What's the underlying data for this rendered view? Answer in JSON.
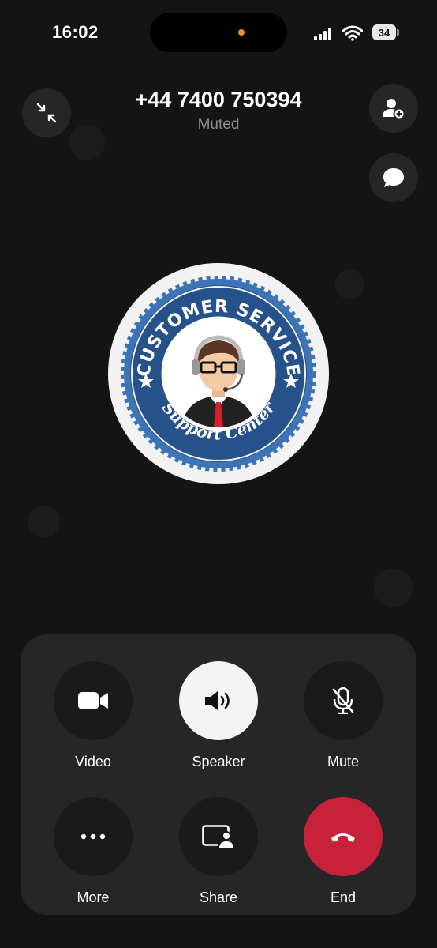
{
  "status_bar": {
    "time": "16:02",
    "battery": "34"
  },
  "call": {
    "number": "+44 7400 750394",
    "status": "Muted"
  },
  "avatar": {
    "badge_top_text": "CUSTOMER SERVICE",
    "badge_bottom_text": "Support Center"
  },
  "controls": {
    "video": "Video",
    "speaker": "Speaker",
    "mute": "Mute",
    "more": "More",
    "share": "Share",
    "end": "End"
  },
  "colors": {
    "end_call": "#c8213a",
    "badge_blue": "#26518a",
    "background": "#141414"
  }
}
